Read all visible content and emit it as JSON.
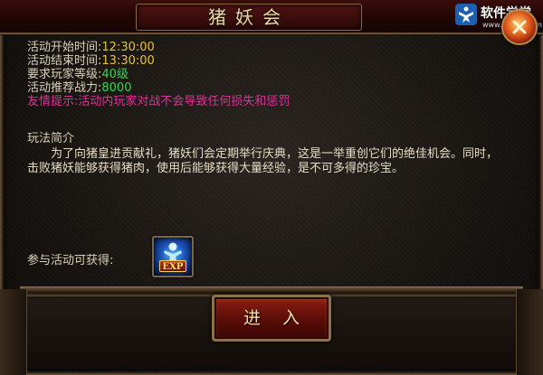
{
  "window": {
    "title": "猪妖会"
  },
  "watermark": {
    "name": "软件学堂",
    "url": "www.xue51.com"
  },
  "event_info": [
    {
      "label": "活动开始时间:",
      "value": "12:30:00"
    },
    {
      "label": "活动结束时间:",
      "value": "13:30:00"
    },
    {
      "label": "要求玩家等级:",
      "value": "40级"
    },
    {
      "label": "活动推荐战力:",
      "value": "8000"
    }
  ],
  "tip": "友情提示:活动内玩家对战不会导致任何损失和惩罚",
  "intro": {
    "title": "玩法简介",
    "body": "为了向猪皇进贡献礼，猪妖们会定期举行庆典，这是一举重创它们的绝佳机会。同时，击败猪妖能够获得猪肉，使用后能够获得大量经验，是不可多得的珍宝。"
  },
  "reward": {
    "label": "参与活动可获得:",
    "icon": "exp-icon",
    "tag": "EXP"
  },
  "enter_button": {
    "label": "进入"
  },
  "colors": {
    "value_yellow": "#e8c23a",
    "value_green": "#33d64e",
    "tip_pink": "#e0309a",
    "title_gold": "#e9d7a6"
  }
}
